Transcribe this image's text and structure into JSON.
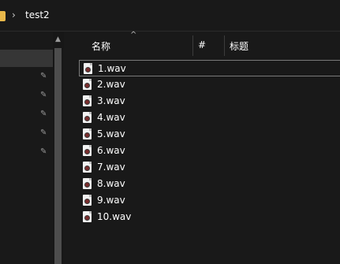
{
  "address": {
    "current_folder": "test2",
    "separator": "›"
  },
  "columns": {
    "name": "名称",
    "number": "#",
    "title": "标题"
  },
  "files": [
    {
      "name": "1.wav"
    },
    {
      "name": "2.wav"
    },
    {
      "name": "3.wav"
    },
    {
      "name": "4.wav"
    },
    {
      "name": "5.wav"
    },
    {
      "name": "6.wav"
    },
    {
      "name": "7.wav"
    },
    {
      "name": "8.wav"
    },
    {
      "name": "9.wav"
    },
    {
      "name": "10.wav"
    }
  ],
  "colors": {
    "background": "#191919",
    "folder": "#e8b84a",
    "text": "#ffffff"
  },
  "icons": {
    "file": "audio-file-icon",
    "pin": "pin-icon",
    "folder": "folder-icon"
  }
}
